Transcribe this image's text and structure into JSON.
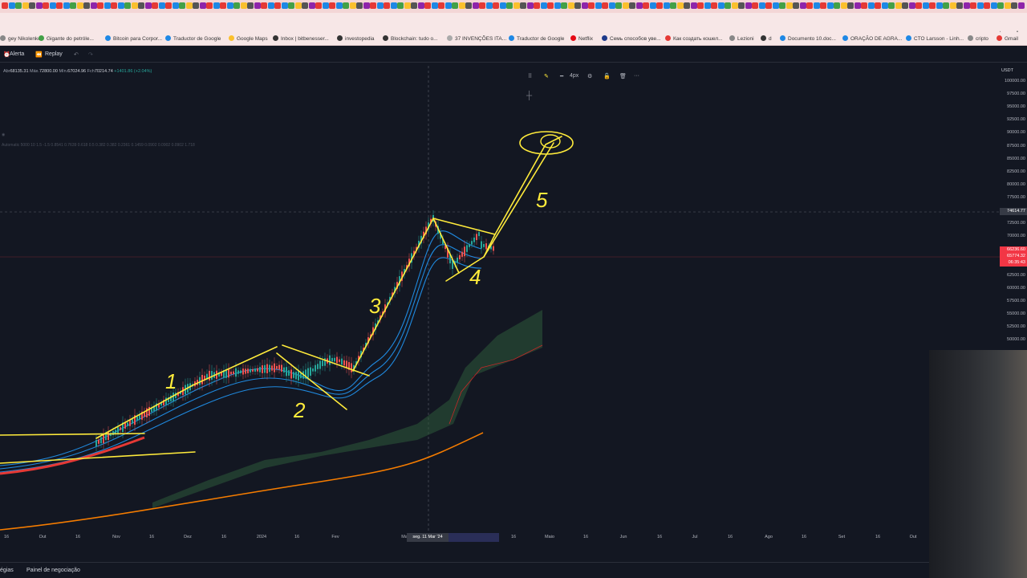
{
  "browser": {
    "bookmarks": [
      {
        "label": "gey Nikolenko",
        "color": "#888888"
      },
      {
        "label": "Gigante do petróle...",
        "color": "#43a047"
      },
      {
        "label": "Bitcoin para Corpor...",
        "color": "#1e88e5"
      },
      {
        "label": "Traductor de Google",
        "color": "#1e88e5"
      },
      {
        "label": "Google Maps",
        "color": "#fbc02d"
      },
      {
        "label": "Inbox | bitbenesser...",
        "color": "#333333"
      },
      {
        "label": "investopedia",
        "color": "#333333"
      },
      {
        "label": "Blockchain: tudo o...",
        "color": "#333333"
      },
      {
        "label": "37 INVENÇÕES ITA...",
        "color": "#aaaaaa"
      },
      {
        "label": "Traductor de Google",
        "color": "#1e88e5"
      },
      {
        "label": "Netflix",
        "color": "#e50914"
      },
      {
        "label": "Семь способов уве...",
        "color": "#1e3a8a"
      },
      {
        "label": "Как создать кошел...",
        "color": "#e53935"
      },
      {
        "label": "Lezioni",
        "color": "#888888"
      },
      {
        "label": "d",
        "color": "#333333"
      },
      {
        "label": "Documento 10.doc...",
        "color": "#1e88e5"
      },
      {
        "label": "ORAÇÃO DE AGRA...",
        "color": "#1e88e5"
      },
      {
        "label": "CTO Larsson - Linh...",
        "color": "#1e88e5"
      },
      {
        "label": "cripto",
        "color": "#888888"
      },
      {
        "label": "Gmail",
        "color": "#e53935"
      }
    ]
  },
  "toolbar": {
    "alert_label": "Alerta",
    "replay_label": "Replay"
  },
  "legend": {
    "open_label": "Abr",
    "open_value": "68135.31",
    "high_label": "Máx.",
    "high_value": "72800.00",
    "low_label": "Mín.",
    "low_value": "67024.96",
    "close_label": "Fch",
    "close_value": "70214.74",
    "change": "+1401.86 (+2.04%)",
    "fib_text": "Automatic 5000 10 1.5 -1.5 0.8541 0.7639 0.618 0.5 0.382 0.382 0.2361 0.1459 0.0902 0.0902 0.0902 1.718"
  },
  "drawing_toolbar": {
    "width_label": "4px"
  },
  "price_axis": {
    "currency": "USDT",
    "ticks": [
      "100000.00",
      "97500.00",
      "95000.00",
      "92500.00",
      "90000.00",
      "87500.00",
      "85000.00",
      "82500.00",
      "80000.00",
      "77500.00",
      "75000.00",
      "72500.00",
      "70000.00",
      "67500.00",
      "65000.00",
      "62500.00",
      "60000.00",
      "57500.00",
      "55000.00",
      "52500.00",
      "50000.00"
    ],
    "crosshair_price": "74614.77",
    "live_price": "66236.60",
    "live_price_2": "65774.32",
    "countdown": "06:35:43"
  },
  "time_axis": {
    "ticks": [
      "16",
      "Out",
      "16",
      "Nov",
      "16",
      "Dez",
      "16",
      "2024",
      "16",
      "Fev",
      "Mar",
      "Abr",
      "16",
      "Maio",
      "16",
      "Jun",
      "16",
      "Jul",
      "16",
      "Ago",
      "16",
      "Set",
      "16",
      "Out"
    ],
    "crosshair_date": "seg. 11 Mar '24"
  },
  "bottom_panel": {
    "strategies_label": "égias",
    "trading_panel_label": "Painel de negociação"
  },
  "annotations": [
    "1",
    "2",
    "3",
    "4",
    "5"
  ],
  "colors": {
    "background": "#131722",
    "up_candle": "#26a69a",
    "down_candle": "#ef5350",
    "drawing": "#ffeb3b",
    "ema_blue": "#2196f3",
    "ema_orange": "#f57c00",
    "cloud_green": "#2e5a3a"
  }
}
